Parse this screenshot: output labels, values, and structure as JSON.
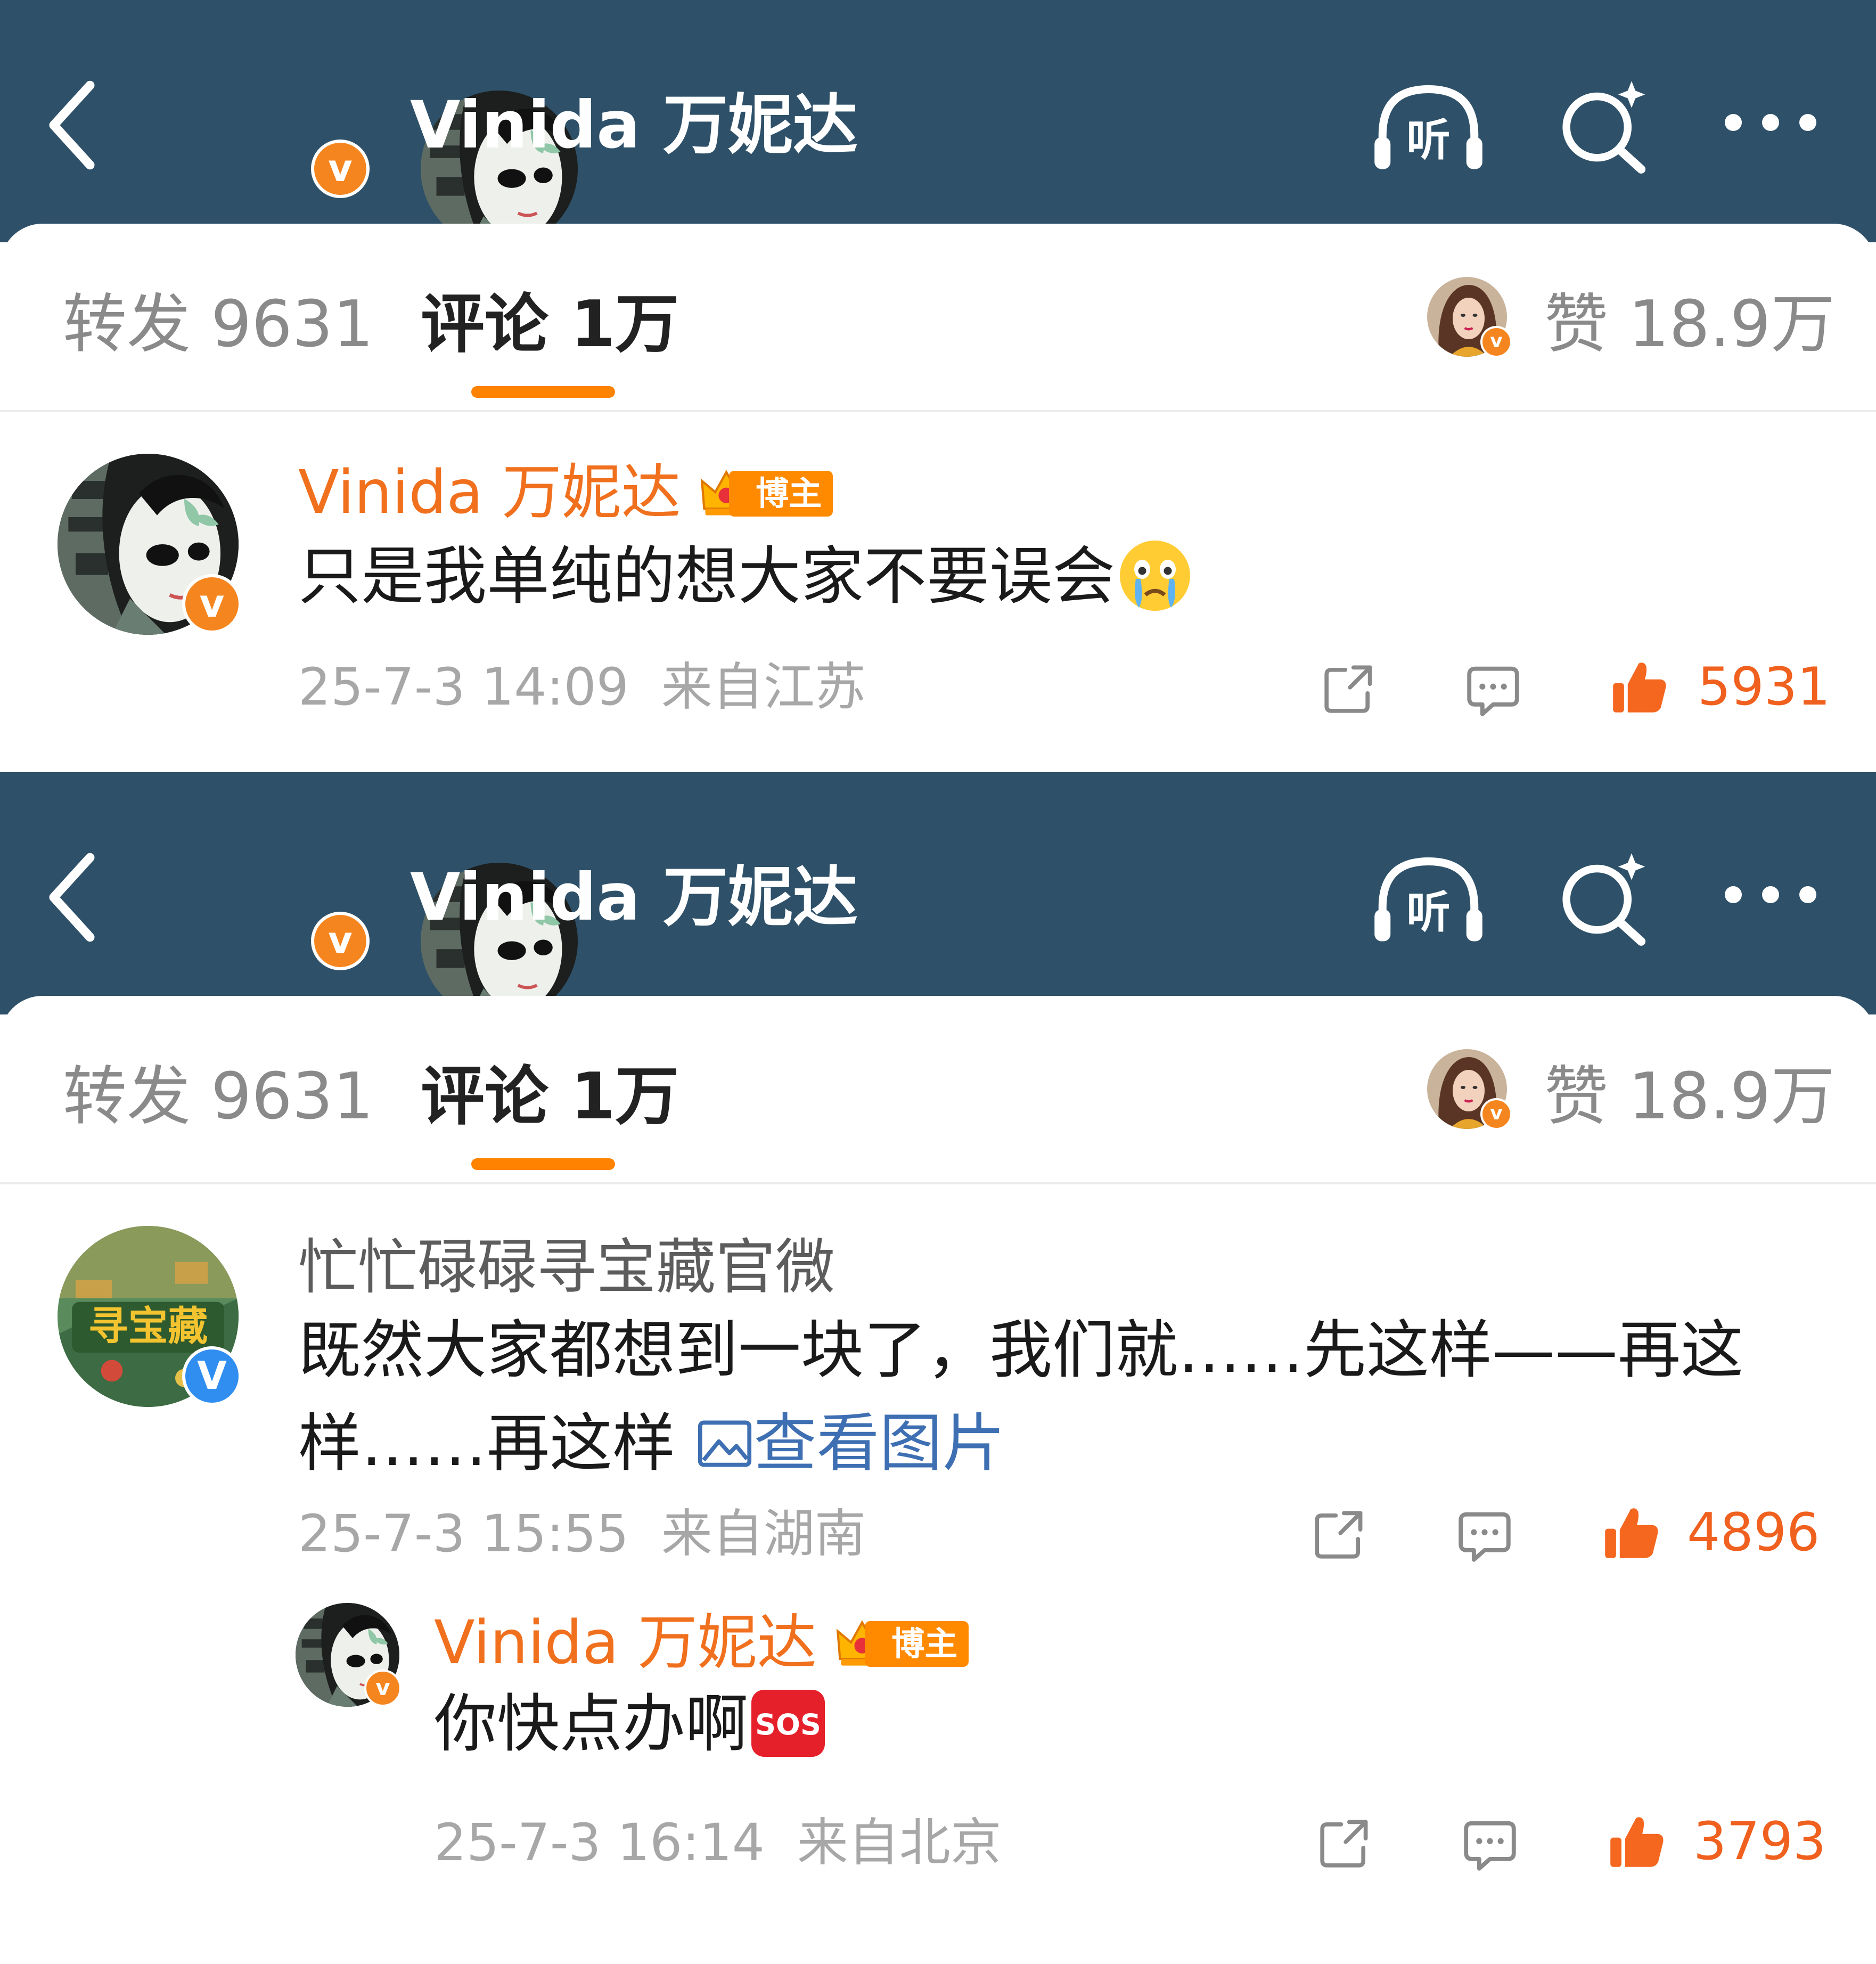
{
  "colors": {
    "header_bg": "#2e5169",
    "accent": "#ff8200",
    "name_orange": "#f0701e",
    "link_blue": "#3e6fb2",
    "meta_gray": "#a7a7a7"
  },
  "header": {
    "title": "Vinida 万妮达",
    "back_icon": "chevron-left-icon",
    "listen_label": "听",
    "search_icon": "search-icon",
    "more_icon": "more-icon"
  },
  "tabs": {
    "repost": "转发 9631",
    "comment": "评论 1万",
    "like": "赞 18.9万"
  },
  "badges": {
    "verified": "V",
    "verified_lower": "v",
    "host": "博主"
  },
  "comments": [
    {
      "name": "Vinida 万妮达",
      "text": "只是我单纯的想大家不要误会",
      "emoji": "crying-face-emoji",
      "time": "25-7-3 14:09",
      "location": "来自江苏",
      "likes": "5931"
    },
    {
      "name": "忙忙碌碌寻宝藏官微",
      "text": "既然大家都想到一块了，我们就……先这样——再这样……再这样",
      "link": "查看图片",
      "time": "25-7-3 15:55",
      "location": "来自湖南",
      "likes": "4896"
    },
    {
      "name": "Vinida 万妮达",
      "text": "你快点办啊",
      "emoji": "sos-emoji",
      "time": "25-7-3 16:14",
      "location": "来自北京",
      "likes": "3793"
    }
  ]
}
